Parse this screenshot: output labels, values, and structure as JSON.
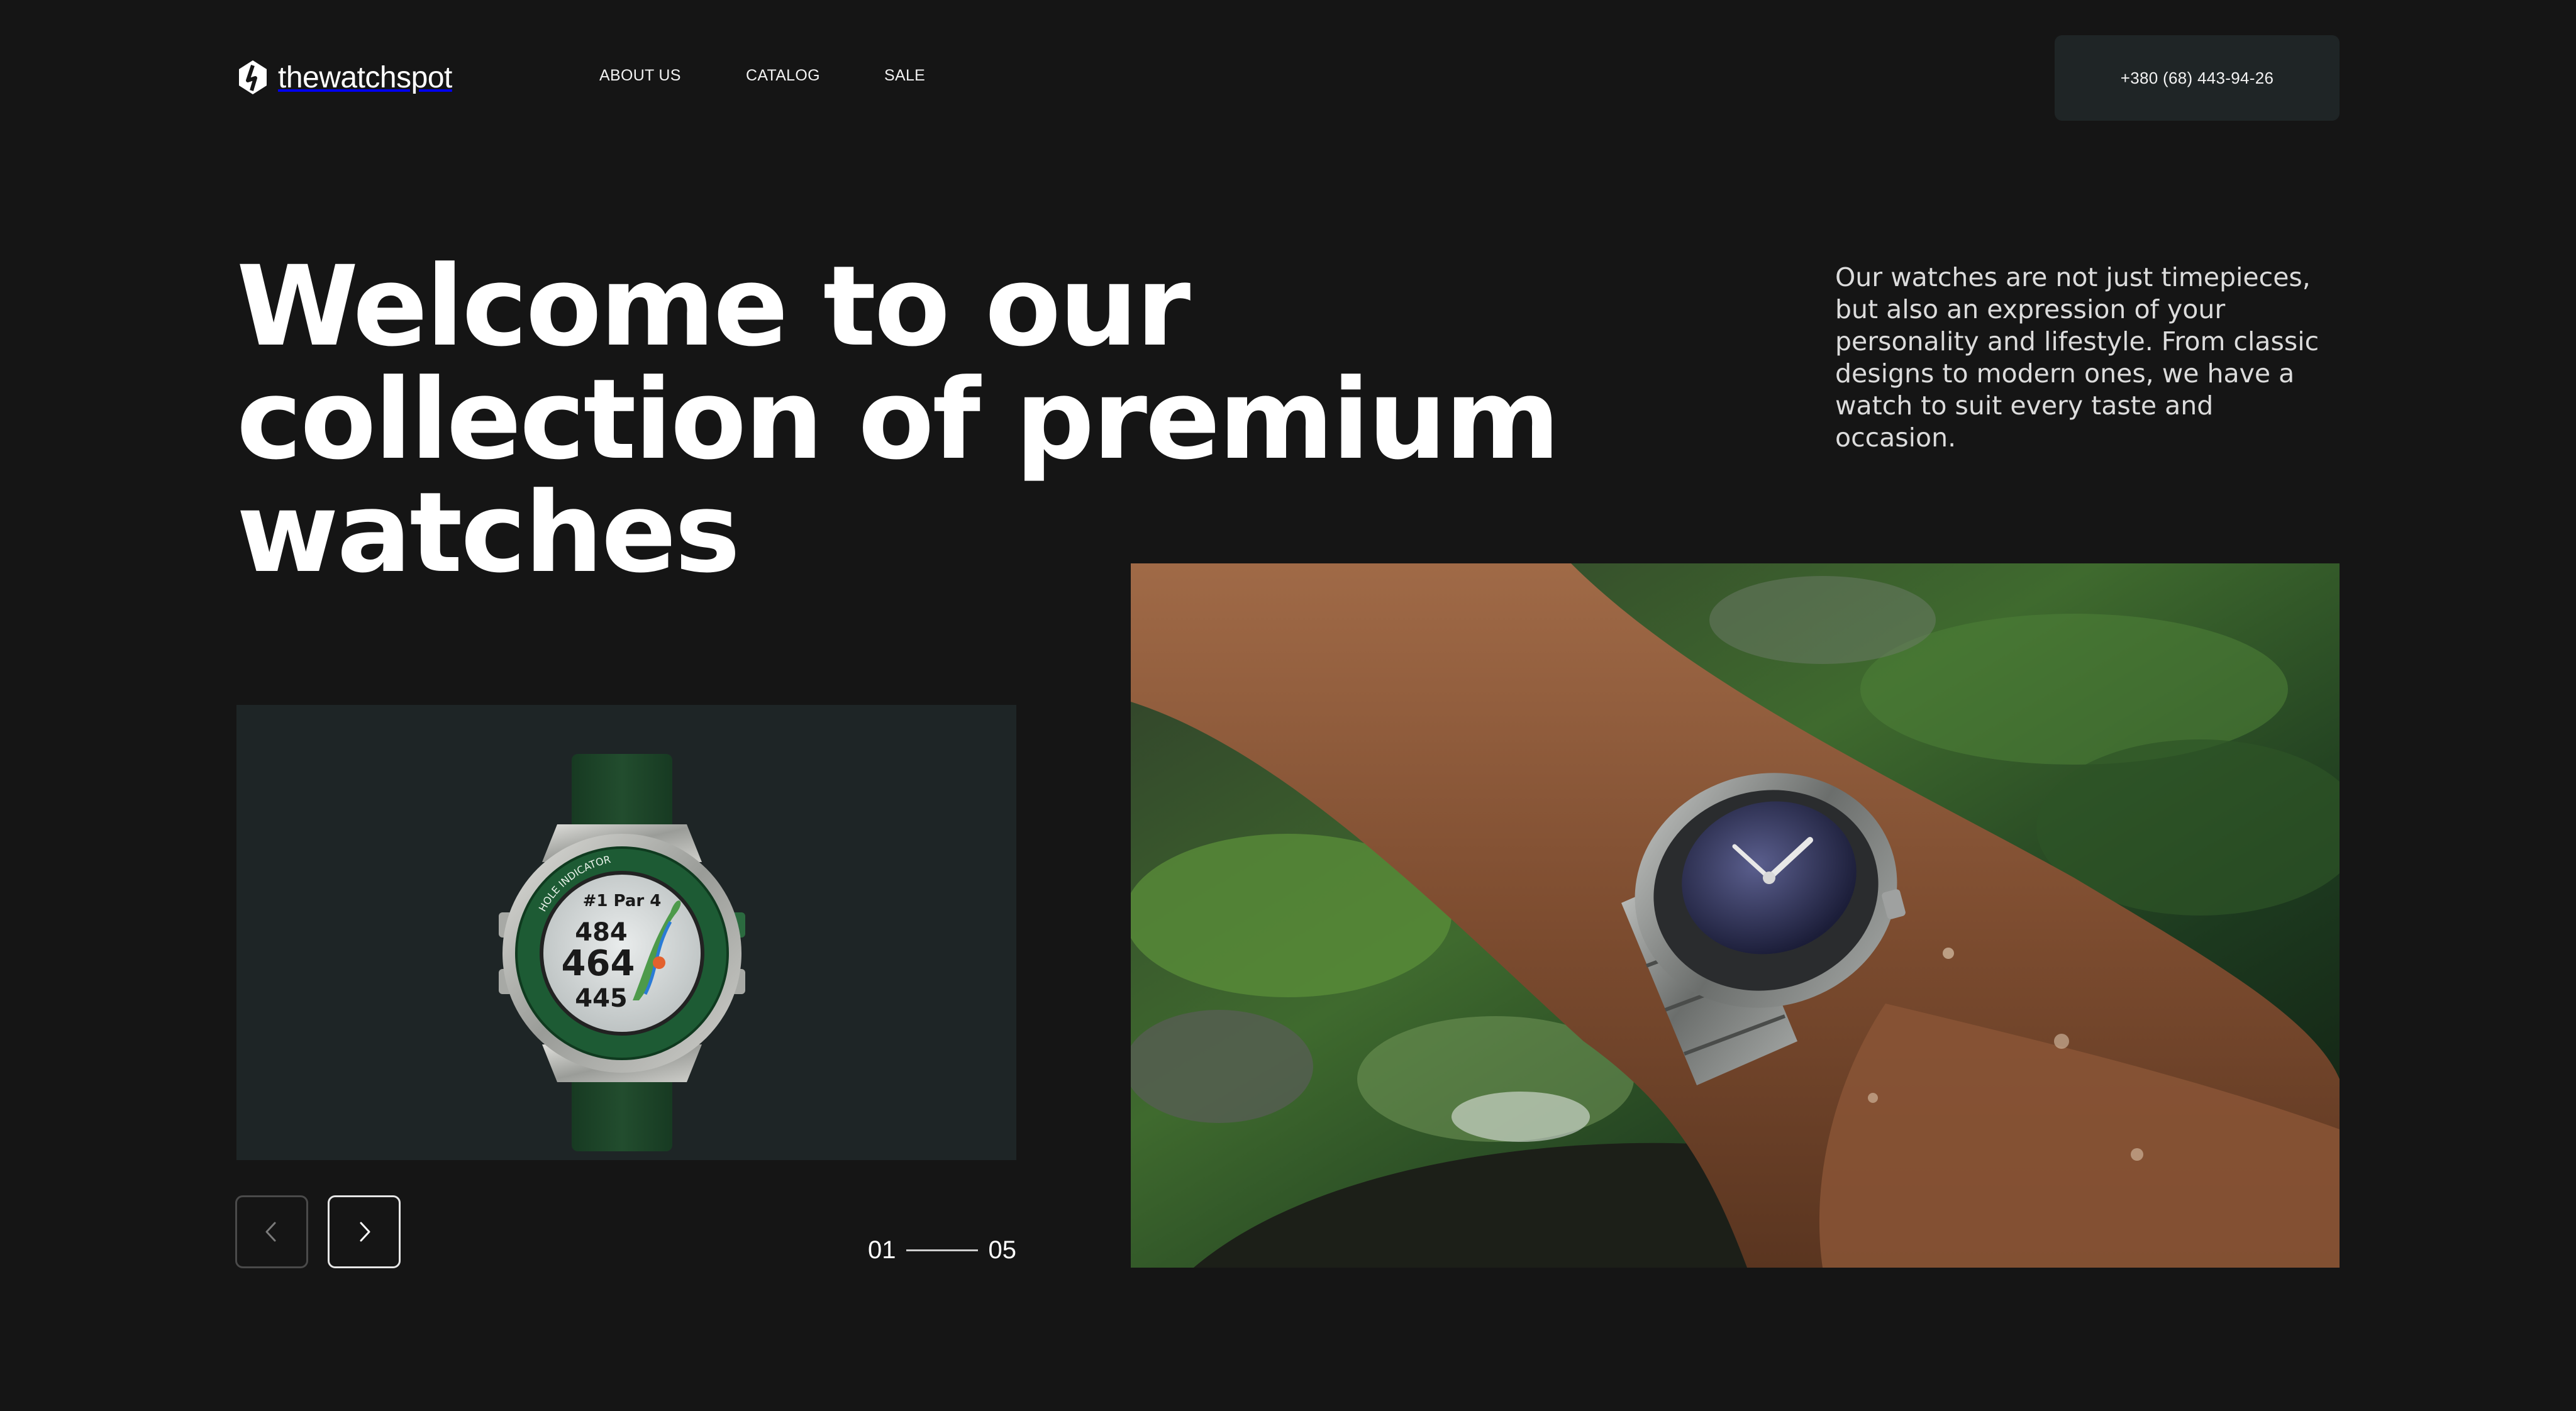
{
  "header": {
    "logo_text": "thewatchspot",
    "nav": [
      {
        "label": "ABOUT US"
      },
      {
        "label": "CATALOG"
      },
      {
        "label": "SALE"
      }
    ],
    "phone": "+380 (68) 443-94-26"
  },
  "hero": {
    "title": "Welcome to our collection of premium watches",
    "description": "Our watches are not just timepieces, but also an expression of your personality and lifestyle. From classic designs to modern ones, we have a watch to suit every taste and occasion."
  },
  "product": {
    "watch_face": {
      "hole": "#1 Par 4",
      "distance_back": "484",
      "distance_middle": "464",
      "distance_front": "445",
      "bezel_label": "HOLE INDICATOR"
    }
  },
  "slider": {
    "current": "01",
    "total": "05"
  },
  "colors": {
    "background": "#151515",
    "card": "#1e2526",
    "button": "#1f2526",
    "watch_green": "#1d5b34"
  },
  "icons": {
    "logo": "logo-mark-icon",
    "prev": "chevron-left-icon",
    "next": "chevron-right-icon"
  }
}
